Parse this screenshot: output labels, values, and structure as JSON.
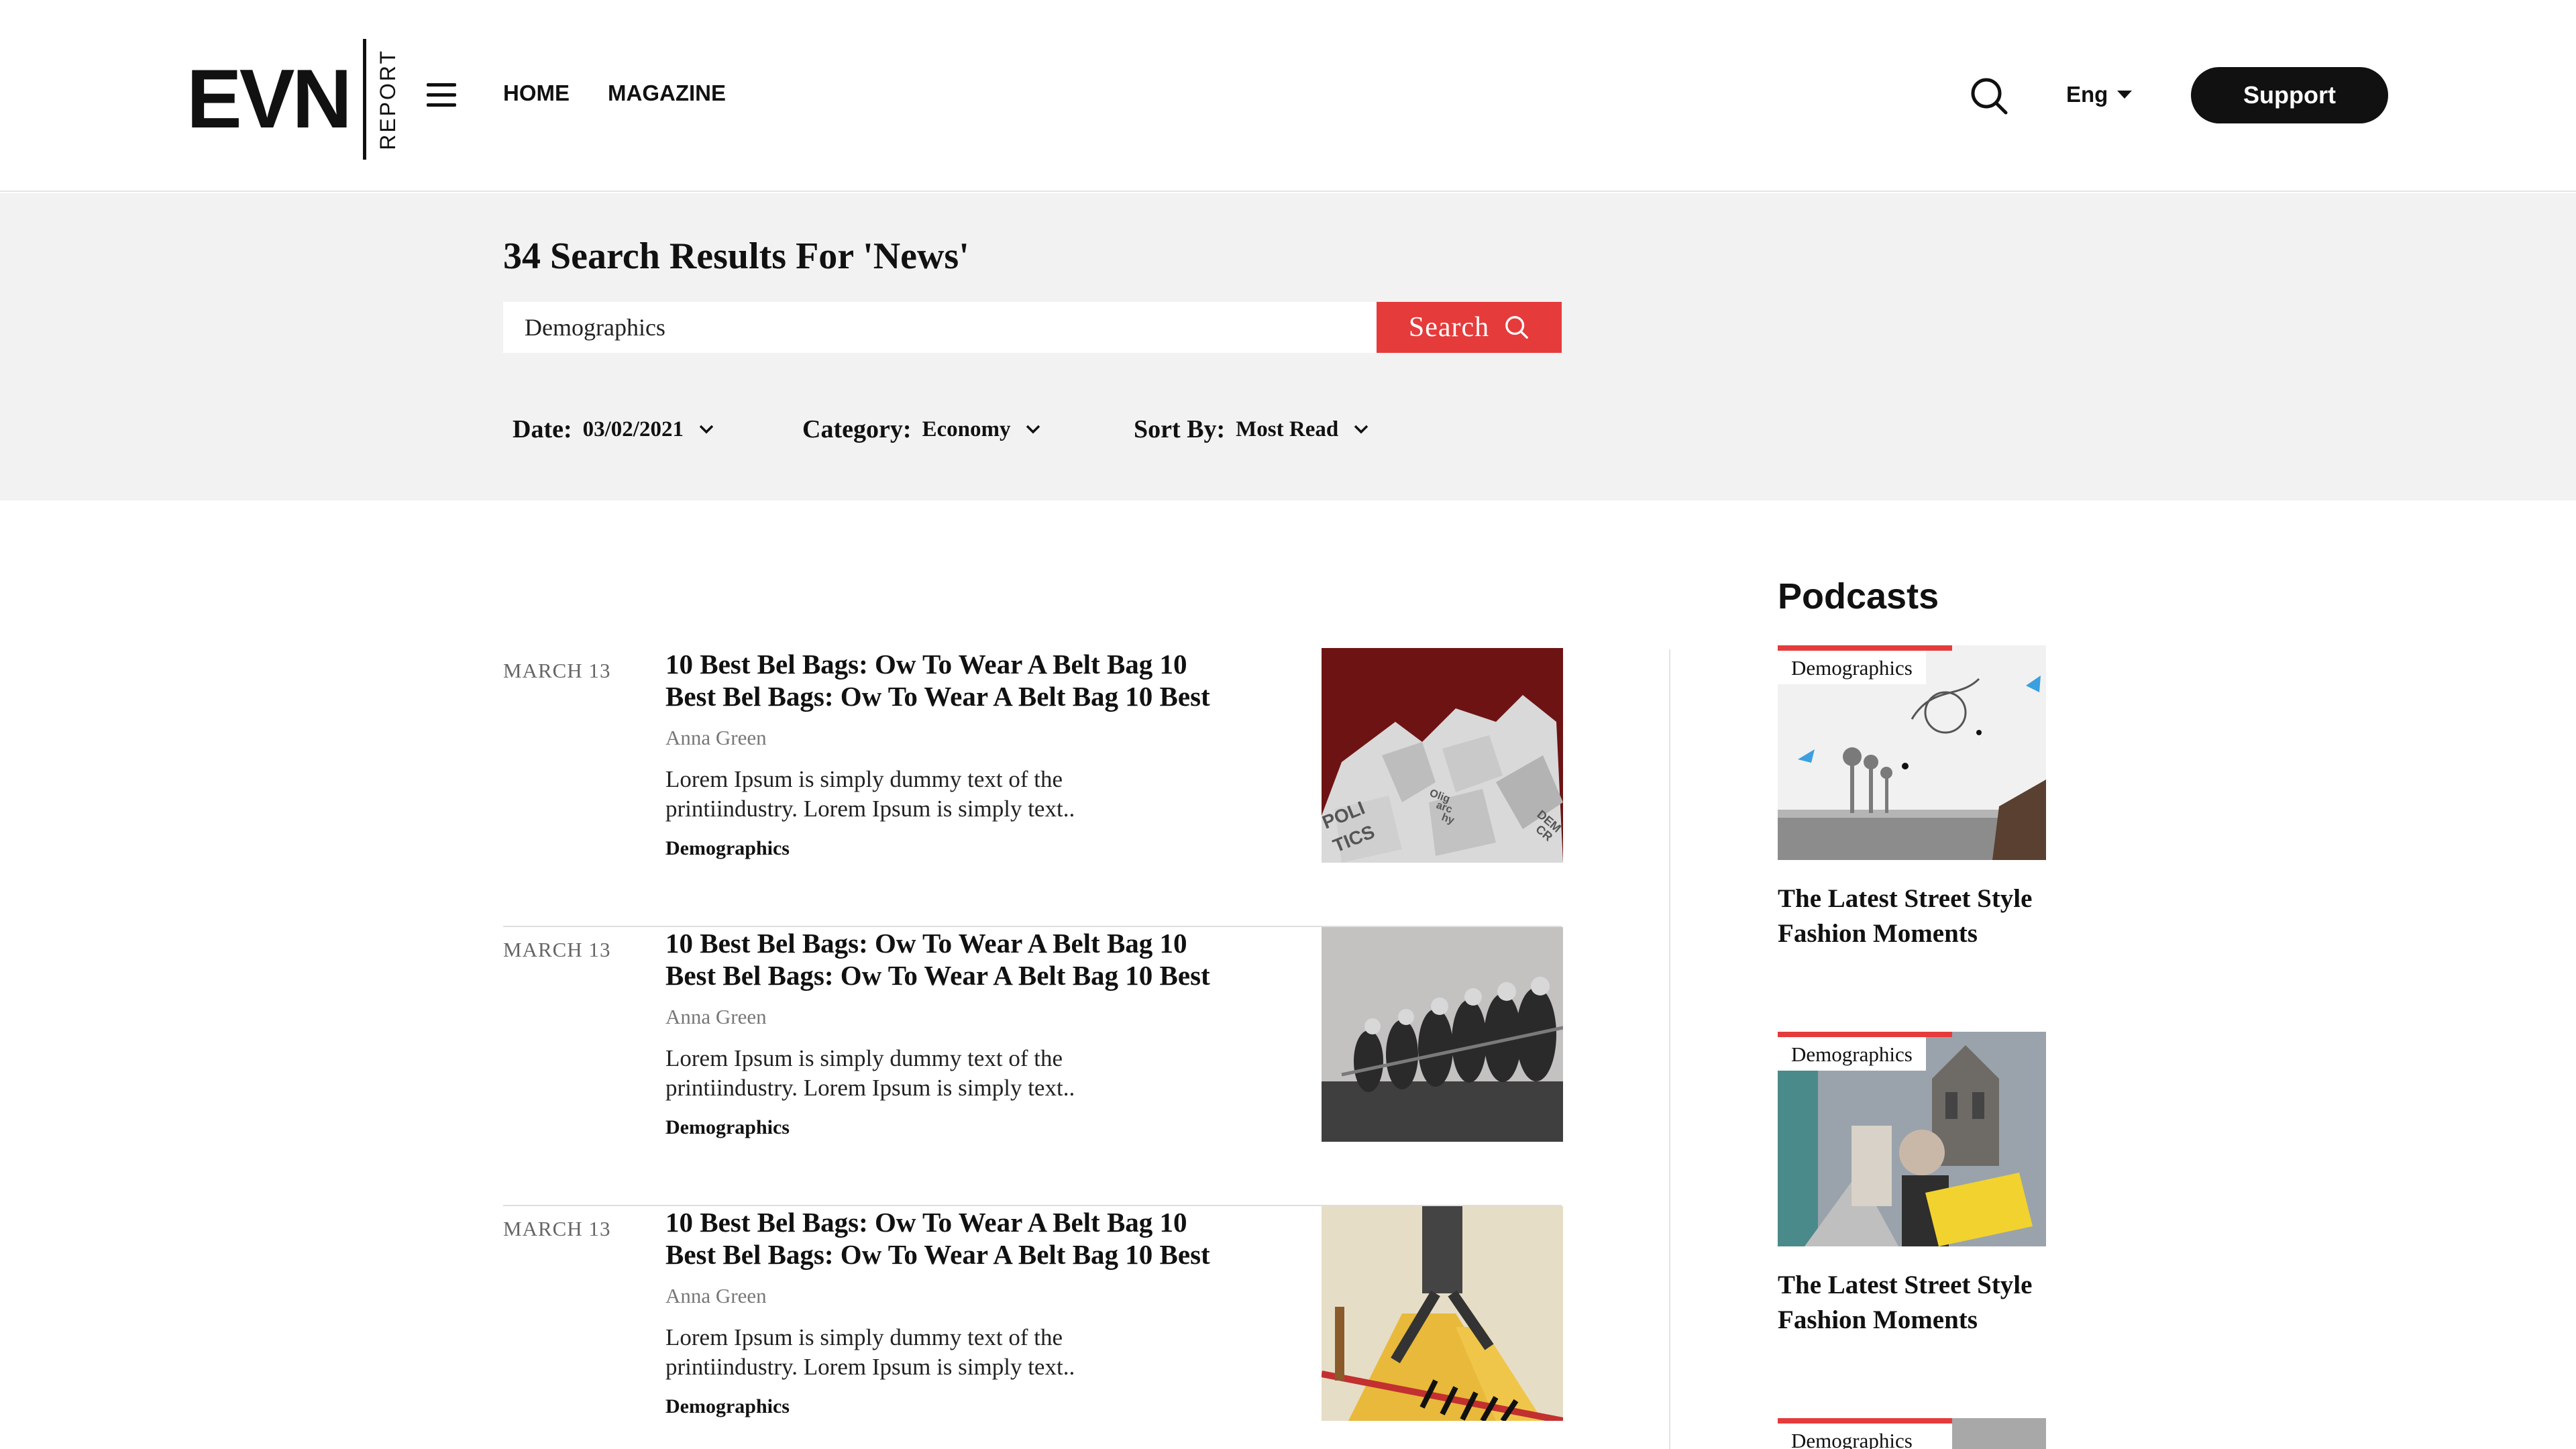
{
  "header": {
    "logo_main": "EVN",
    "logo_sub": "REPORT",
    "nav": [
      {
        "label": "HOME"
      },
      {
        "label": "MAGAZINE"
      }
    ],
    "language": "Eng",
    "support_label": "Support"
  },
  "search": {
    "results_title": "34 Search Results For 'News'",
    "query_value": "Demographics",
    "button_label": "Search",
    "filters": [
      {
        "label": "Date:",
        "value": "03/02/2021"
      },
      {
        "label": "Category:",
        "value": "Economy"
      },
      {
        "label": "Sort By:",
        "value": "Most Read"
      }
    ]
  },
  "results": [
    {
      "date": "MARCH 13",
      "title_line1": "10 Best Bel Bags: Ow To Wear A Belt Bag 10",
      "title_line2": "Best Bel Bags:  Ow To Wear A Belt Bag 10 Best",
      "author": "Anna Green",
      "excerpt_line1": "Lorem Ipsum is simply dummy text of the",
      "excerpt_line2": "printiindustry. Lorem Ipsum is simply text..",
      "tag": "Demographics",
      "thumb_text": [
        "POLI",
        "TICS",
        "Olig",
        "arc",
        "hy",
        "DEM",
        "CR"
      ]
    },
    {
      "date": "MARCH 13",
      "title_line1": "10 Best Bel Bags: Ow To Wear A Belt Bag 10",
      "title_line2": "Best Bel Bags:  Ow To Wear A Belt Bag 10 Best",
      "author": "Anna Green",
      "excerpt_line1": "Lorem Ipsum is simply dummy text of the",
      "excerpt_line2": "printiindustry. Lorem Ipsum is simply text..",
      "tag": "Demographics"
    },
    {
      "date": "MARCH 13",
      "title_line1": "10 Best Bel Bags: Ow To Wear A Belt Bag 10",
      "title_line2": "Best Bel Bags:  Ow To Wear A Belt Bag 10 Best",
      "author": "Anna Green",
      "excerpt_line1": "Lorem Ipsum is simply dummy text of the",
      "excerpt_line2": "printiindustry. Lorem Ipsum is simply text..",
      "tag": "Demographics"
    }
  ],
  "podcasts": {
    "heading": "Podcasts",
    "items": [
      {
        "tag": "Demographics",
        "title_line1": "The Latest Street Style",
        "title_line2": "Fashion Moments"
      },
      {
        "tag": "Demographics",
        "title_line1": "The Latest Street Style",
        "title_line2": "Fashion Moments"
      },
      {
        "tag": "Demographics"
      }
    ]
  },
  "colors": {
    "accent": "#e53b3b",
    "text": "#111111",
    "band_bg": "#f2f2f2"
  }
}
